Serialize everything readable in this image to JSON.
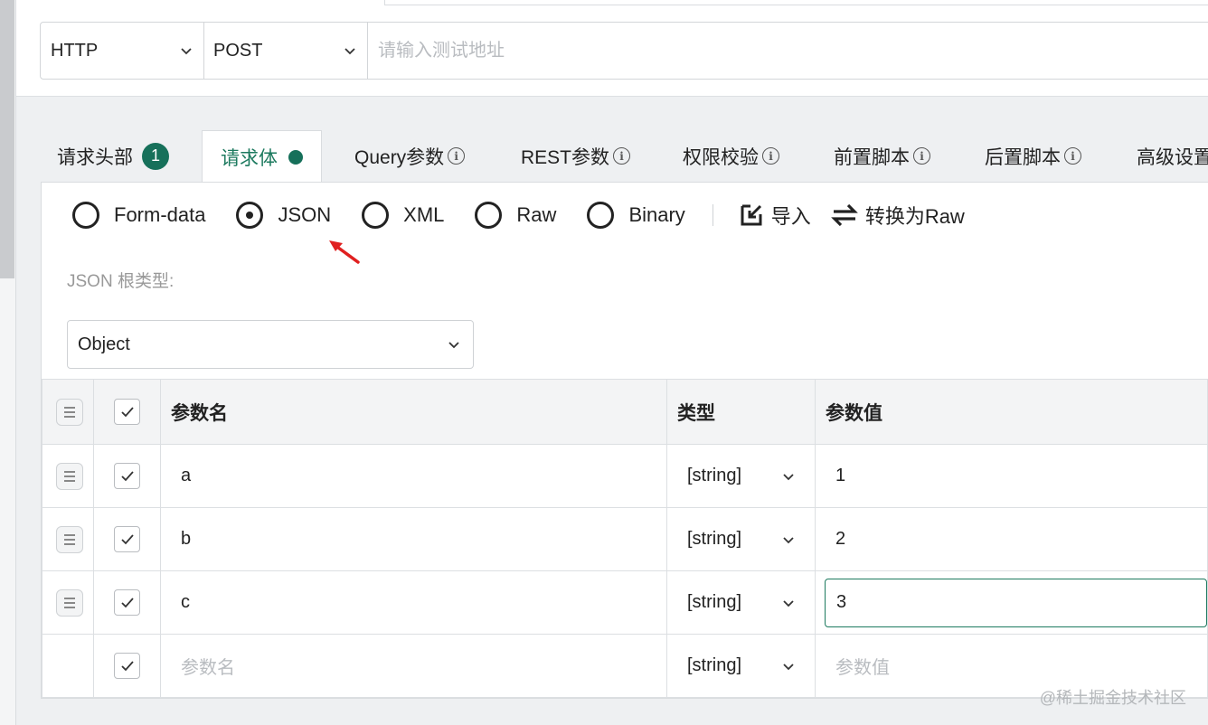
{
  "url_bar": {
    "protocol": "HTTP",
    "method": "POST",
    "placeholder": "请输入测试地址"
  },
  "tabs": [
    {
      "label": "请求头部",
      "badge": "1"
    },
    {
      "label": "请求体"
    },
    {
      "label": "Query参数"
    },
    {
      "label": "REST参数"
    },
    {
      "label": "权限校验"
    },
    {
      "label": "前置脚本"
    },
    {
      "label": "后置脚本"
    },
    {
      "label": "高级设置"
    }
  ],
  "active_tab": "请求体",
  "body_types": {
    "options": [
      "Form-data",
      "JSON",
      "XML",
      "Raw",
      "Binary"
    ],
    "selected": "JSON"
  },
  "tools": {
    "import_label": "导入",
    "convert_label": "转换为Raw"
  },
  "root_type": {
    "label": "JSON 根类型:",
    "value": "Object"
  },
  "table": {
    "headers": {
      "name": "参数名",
      "type": "类型",
      "value": "参数值"
    },
    "rows": [
      {
        "name": "a",
        "type": "[string]",
        "value": "1",
        "checked": true
      },
      {
        "name": "b",
        "type": "[string]",
        "value": "2",
        "checked": true
      },
      {
        "name": "c",
        "type": "[string]",
        "value": "3",
        "checked": true
      }
    ],
    "new_row": {
      "name_placeholder": "参数名",
      "type": "[string]",
      "value_placeholder": "参数值",
      "checked": true
    }
  },
  "watermark": "@稀土掘金技术社区",
  "colors": {
    "accent": "#16705a",
    "arrow": "#e02020"
  }
}
